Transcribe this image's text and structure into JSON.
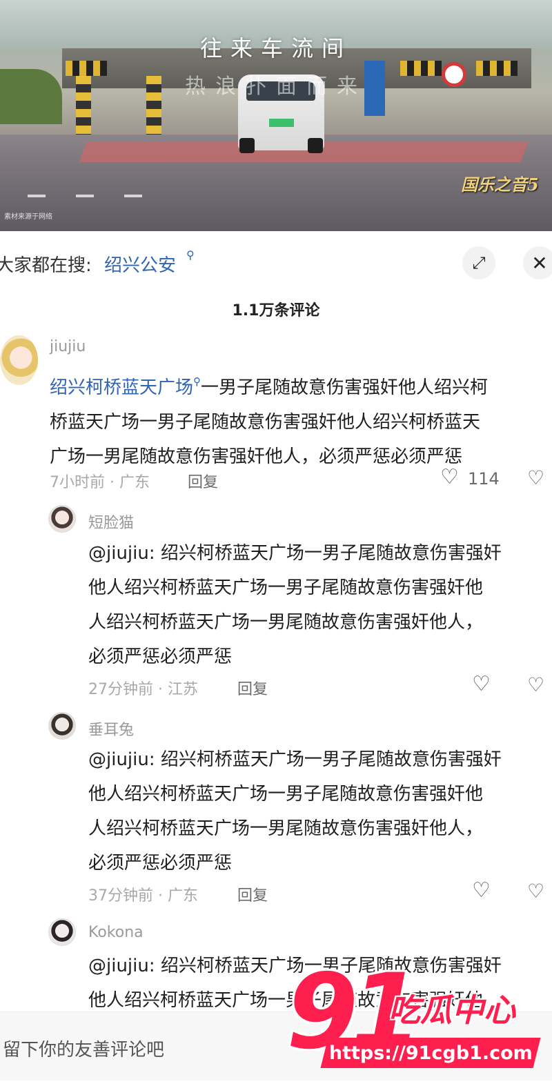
{
  "video": {
    "caption_line1": "往来车流间",
    "caption_line2": "热浪扑面而来",
    "channel_logo": "国乐之音5",
    "source_note": "素材来源于网络"
  },
  "search": {
    "prefix": "大家都在搜:",
    "term": "绍兴公安",
    "term_icon": "search-icon"
  },
  "header": {
    "expand_icon": "expand-icon",
    "close_icon": "close-icon",
    "comment_count": "1.1万条评论"
  },
  "comments": [
    {
      "user": "jiujiu",
      "link_text": "绍兴柯桥蓝天广场",
      "text_line1_rest": "一男子尾随故意伤害强奸他人绍兴柯",
      "text_line2": "桥蓝天广场一男子尾随故意伤害强奸他人绍兴柯桥蓝天",
      "text_line3": "广场一男尾随故意伤害强奸他人，必须严惩必须严惩",
      "meta": "7小时前 · 广东",
      "reply": "回复",
      "likes": "114"
    },
    {
      "user": "短脸猫",
      "line1": "@jiujiu: 绍兴柯桥蓝天广场一男子尾随故意伤害强奸",
      "line2": "他人绍兴柯桥蓝天广场一男子尾随故意伤害强奸他",
      "line3": "人绍兴柯桥蓝天广场一男尾随故意伤害强奸他人，",
      "line4": "必须严惩必须严惩",
      "meta": "27分钟前 · 江苏",
      "reply": "回复"
    },
    {
      "user": "垂耳兔",
      "line1": "@jiujiu: 绍兴柯桥蓝天广场一男子尾随故意伤害强奸",
      "line2": "他人绍兴柯桥蓝天广场一男子尾随故意伤害强奸他",
      "line3": "人绍兴柯桥蓝天广场一男尾随故意伤害强奸他人，",
      "line4": "必须严惩必须严惩",
      "meta": "37分钟前 · 广东",
      "reply": "回复"
    },
    {
      "user": "Kokona",
      "line1": "@jiujiu: 绍兴柯桥蓝天广场一男子尾随故意伤害强奸",
      "line2": "他人绍兴柯桥蓝天广场一男子尾随故意伤害强奸他"
    }
  ],
  "input": {
    "placeholder": "留下你的友善评论吧"
  },
  "watermark": {
    "number": "91",
    "name": "吃瓜中心",
    "url": "https://91cgb1.com"
  },
  "colors": {
    "link": "#2f64b5",
    "watermark": "#ff1f4e"
  }
}
